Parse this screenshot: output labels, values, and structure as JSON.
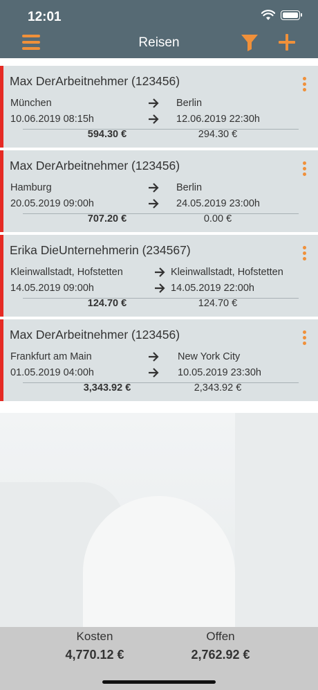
{
  "status": {
    "time": "12:01"
  },
  "header": {
    "title": "Reisen"
  },
  "trips": [
    {
      "employee": "Max DerArbeitnehmer (123456)",
      "from": "München",
      "from_datetime": "10.06.2019 08:15h",
      "to": "Berlin",
      "to_datetime": "12.06.2019 22:30h",
      "cost": "594.30 €",
      "open": "294.30 €"
    },
    {
      "employee": "Max DerArbeitnehmer (123456)",
      "from": "Hamburg",
      "from_datetime": "20.05.2019 09:00h",
      "to": "Berlin",
      "to_datetime": "24.05.2019 23:00h",
      "cost": "707.20 €",
      "open": "0.00 €"
    },
    {
      "employee": "Erika DieUnternehmerin (234567)",
      "from": "Kleinwallstadt, Hofstetten",
      "from_datetime": "14.05.2019 09:00h",
      "to": "Kleinwallstadt, Hofstetten",
      "to_datetime": "14.05.2019 22:00h",
      "cost": "124.70 €",
      "open": "124.70 €"
    },
    {
      "employee": "Max DerArbeitnehmer (123456)",
      "from": "Frankfurt am Main",
      "from_datetime": "01.05.2019 04:00h",
      "to": "New York City",
      "to_datetime": "10.05.2019 23:30h",
      "cost": "3,343.92 €",
      "open": "2,343.92 €"
    }
  ],
  "footer": {
    "cost_label": "Kosten",
    "cost_value": "4,770.12 €",
    "open_label": "Offen",
    "open_value": "2,762.92 €"
  },
  "colors": {
    "header": "#566a74",
    "accent": "#f0903a",
    "card": "#dbe1e3",
    "marker": "#e52a24"
  }
}
